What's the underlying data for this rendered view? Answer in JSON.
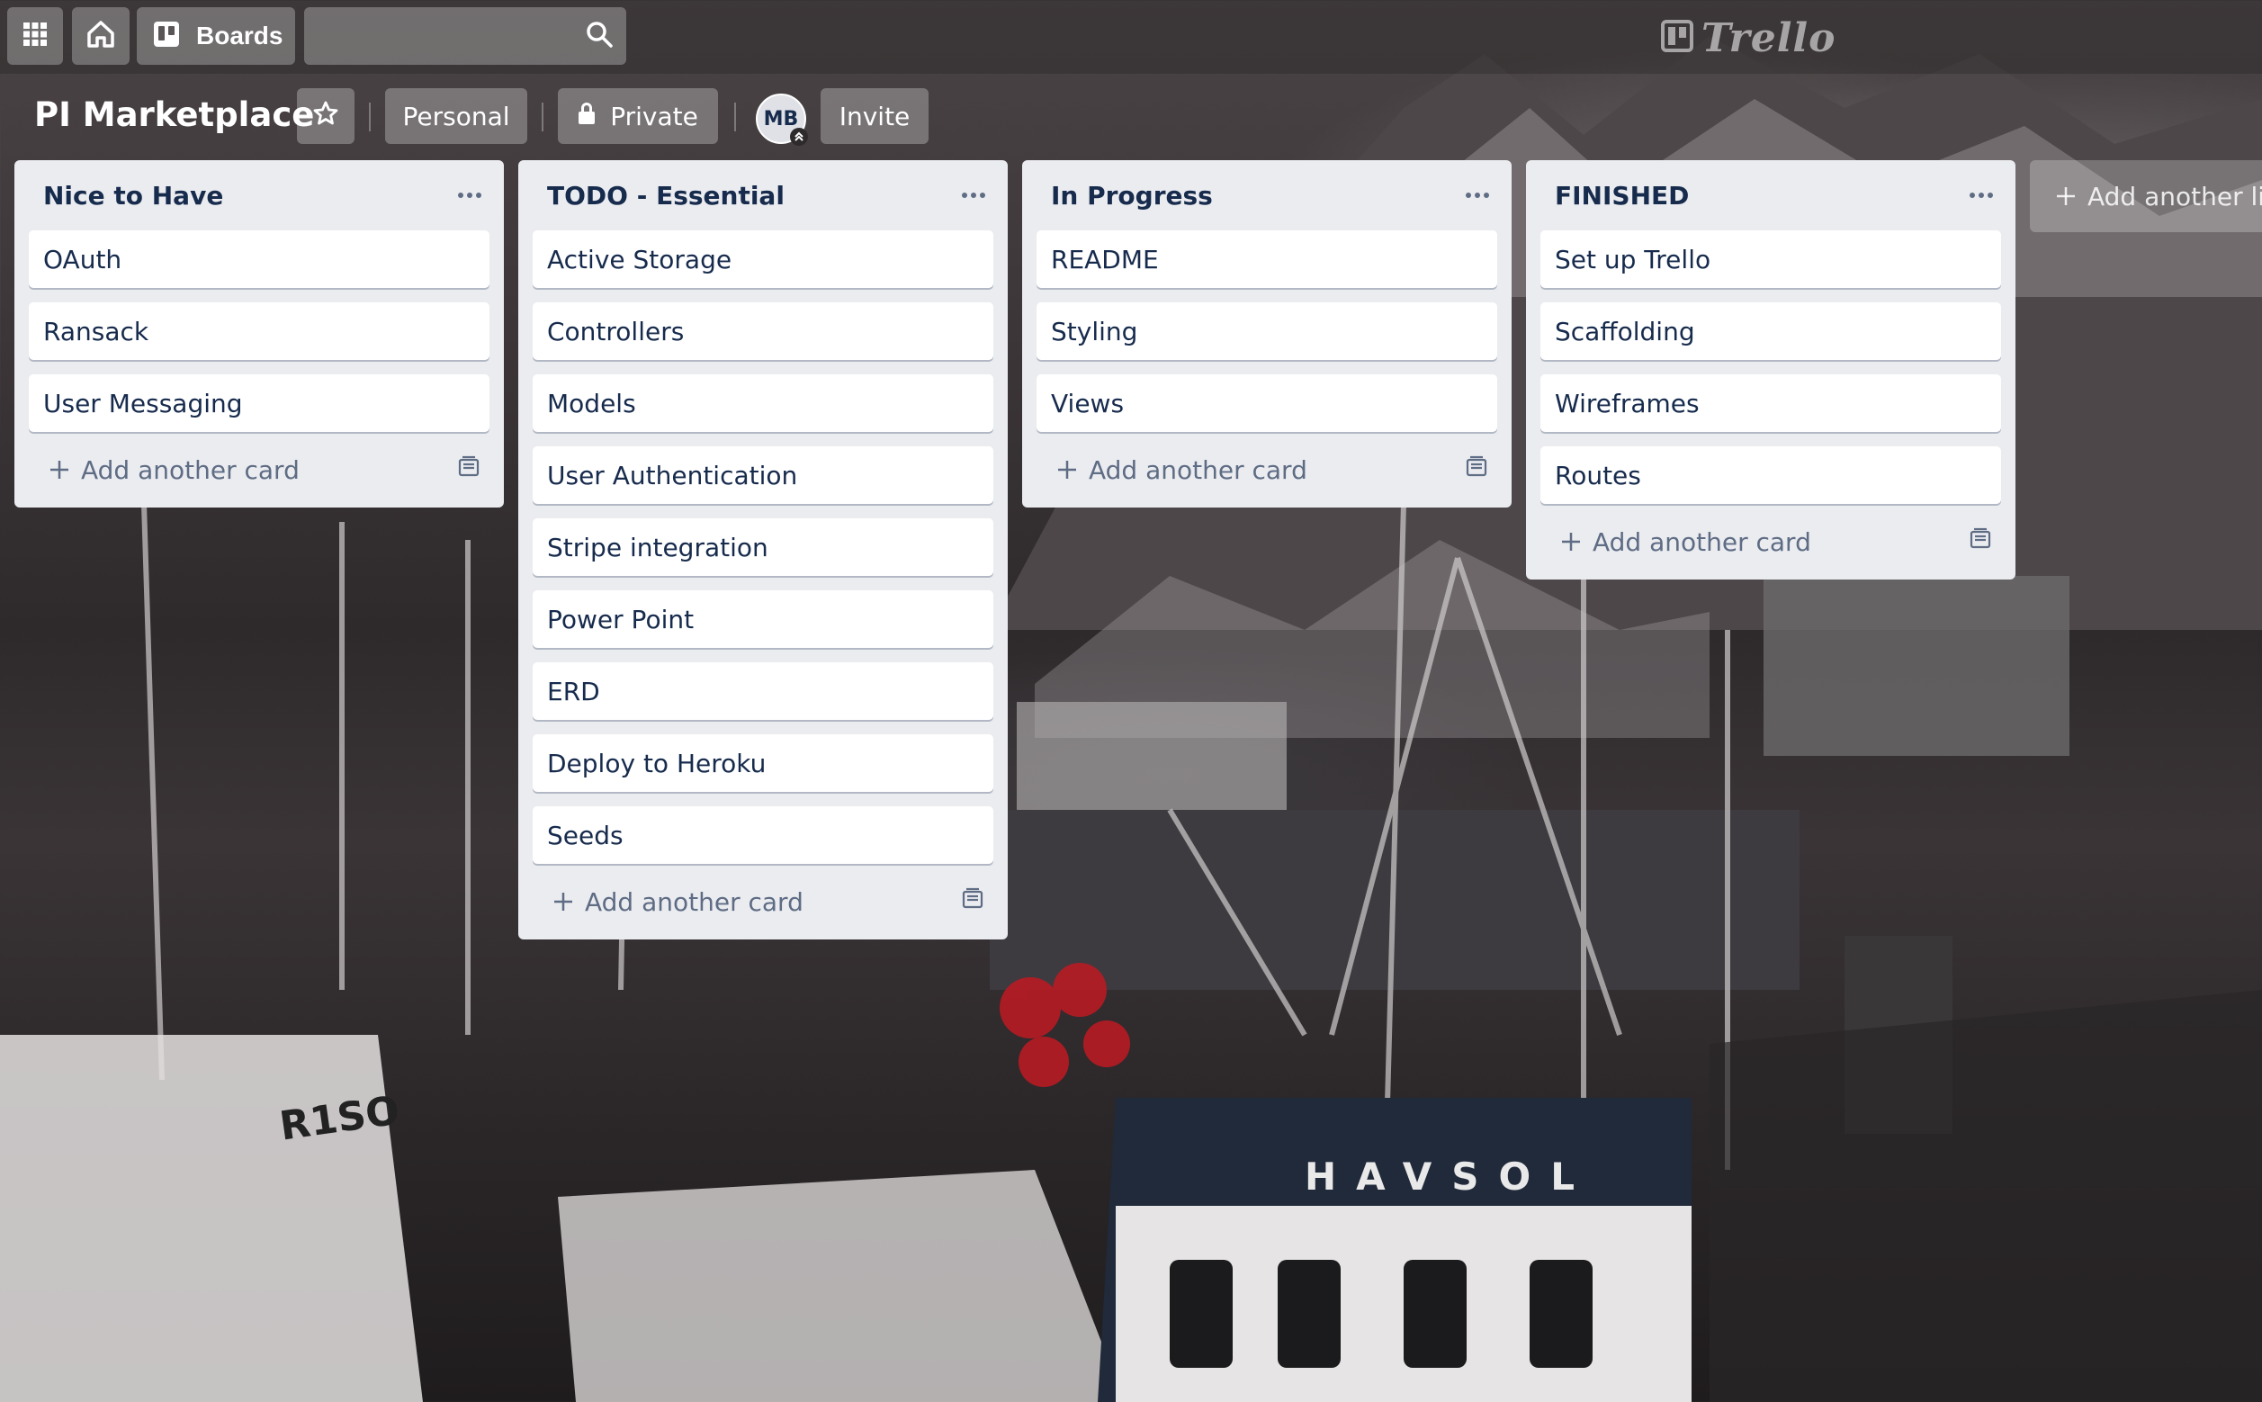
{
  "nav": {
    "boards_label": "Boards",
    "search_value": "",
    "logo_text": "Trello",
    "icons": [
      "apps-grid-icon",
      "home-icon",
      "boards-icon",
      "search-icon"
    ]
  },
  "board": {
    "title": "PI Marketplace",
    "team_label": "Personal",
    "visibility_label": "Private",
    "member_initials": "MB",
    "invite_label": "Invite"
  },
  "lists": [
    {
      "title": "Nice to Have",
      "cards": [
        "OAuth",
        "Ransack",
        "User Messaging"
      ],
      "add_card_label": "Add another card"
    },
    {
      "title": "TODO - Essential",
      "cards": [
        "Active Storage",
        "Controllers",
        "Models",
        "User Authentication",
        "Stripe integration",
        "Power Point",
        "ERD",
        "Deploy to Heroku",
        "Seeds"
      ],
      "add_card_label": "Add another card"
    },
    {
      "title": "In Progress",
      "cards": [
        "README",
        "Styling",
        "Views"
      ],
      "add_card_label": "Add another card"
    },
    {
      "title": "FINISHED",
      "cards": [
        "Set up Trello",
        "Scaffolding",
        "Wireframes",
        "Routes"
      ],
      "add_card_label": "Add another card"
    }
  ],
  "add_list_label": "Add another list",
  "colors": {
    "list_bg": "#ebecf0",
    "card_text": "#172b4d",
    "muted_text": "#5e6c84"
  }
}
